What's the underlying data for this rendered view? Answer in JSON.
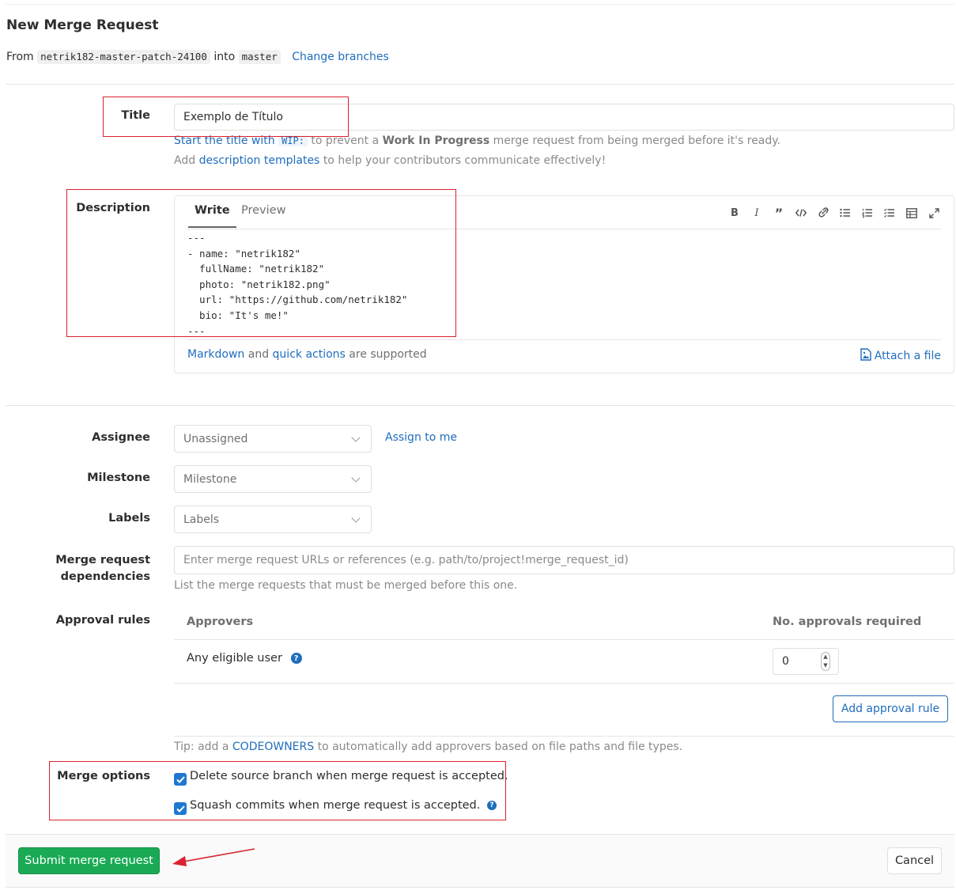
{
  "header": {
    "title": "New Merge Request",
    "from_label": "From",
    "source_branch": "netrik182-master-patch-24100",
    "into_label": "into",
    "target_branch": "master",
    "change_branches": "Change branches"
  },
  "title_field": {
    "label": "Title",
    "value": "Exemplo de Título",
    "help1_link": "Start the title with",
    "help1_code": "WIP:",
    "help1_mid": "to prevent a",
    "help1_bold": "Work In Progress",
    "help1_end": "merge request from being merged before it's ready.",
    "help2_start": "Add",
    "help2_link": "description templates",
    "help2_end": "to help your contributors communicate effectively!"
  },
  "description": {
    "label": "Description",
    "tab_write": "Write",
    "tab_preview": "Preview",
    "toolbar": [
      "bold-icon",
      "italic-icon",
      "quote-icon",
      "code-icon",
      "link-icon",
      "bullet-list-icon",
      "numbered-list-icon",
      "task-list-icon",
      "table-icon",
      "fullscreen-icon"
    ],
    "content": "---\n- name: \"netrik182\"\n  fullName: \"netrik182\"\n  photo: \"netrik182.png\"\n  url: \"https://github.com/netrik182\"\n  bio: \"It's me!\"\n---",
    "footer_markdown": "Markdown",
    "footer_and": "and",
    "footer_quick_actions": "quick actions",
    "footer_supported": "are supported",
    "attach_file": "Attach a file"
  },
  "assignee": {
    "label": "Assignee",
    "value": "Unassigned",
    "assign_to_me": "Assign to me"
  },
  "milestone": {
    "label": "Milestone",
    "value": "Milestone"
  },
  "labels": {
    "label": "Labels",
    "value": "Labels"
  },
  "dependencies": {
    "label_line1": "Merge request",
    "label_line2": "dependencies",
    "placeholder": "Enter merge request URLs or references (e.g. path/to/project!merge_request_id)",
    "help": "List the merge requests that must be merged before this one."
  },
  "approval_rules": {
    "label": "Approval rules",
    "col_approvers": "Approvers",
    "col_required": "No. approvals required",
    "row_name": "Any eligible user",
    "row_value": "0",
    "add_rule": "Add approval rule",
    "tip_start": "Tip: add a",
    "tip_link": "CODEOWNERS",
    "tip_end": "to automatically add approvers based on file paths and file types."
  },
  "merge_options": {
    "label": "Merge options",
    "delete_branch": "Delete source branch when merge request is accepted.",
    "squash_commits": "Squash commits when merge request is accepted."
  },
  "actions": {
    "submit": "Submit merge request",
    "cancel": "Cancel"
  },
  "colors": {
    "accent": "#1f6dbd",
    "submit": "#1aaa55",
    "annotation": "#d9232e"
  }
}
